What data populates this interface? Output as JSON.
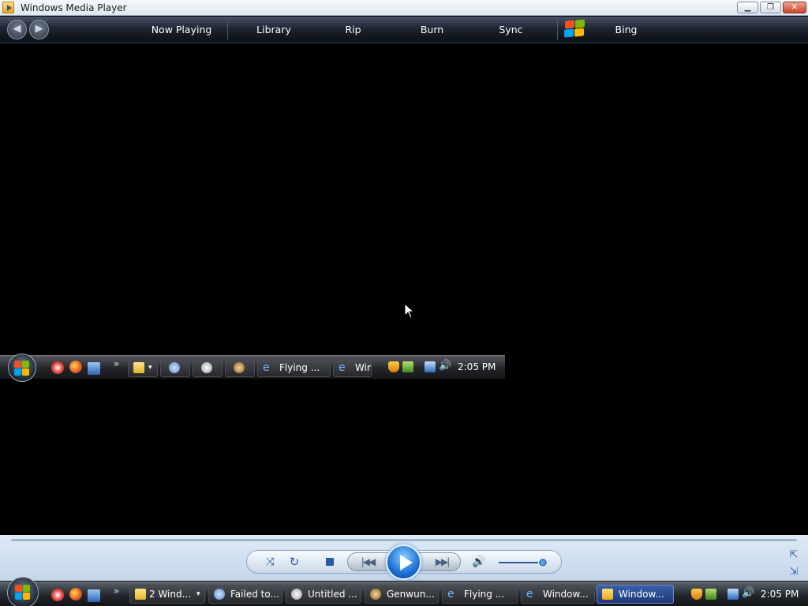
{
  "window": {
    "title": "Windows Media Player",
    "controls": {
      "minimize": "▁",
      "maximize": "❐",
      "close": "✕"
    }
  },
  "nav": {
    "back_icon": "arrow-left-icon",
    "forward_icon": "arrow-right-icon",
    "tabs": [
      {
        "label": "Now Playing"
      },
      {
        "label": "Library"
      },
      {
        "label": "Rip"
      },
      {
        "label": "Burn"
      },
      {
        "label": "Sync"
      },
      {
        "label": "Bing"
      }
    ]
  },
  "mini_taskbar": {
    "buttons": [
      {
        "label": ""
      },
      {
        "label": ""
      },
      {
        "label": ""
      },
      {
        "label": ""
      },
      {
        "label": "Flying ..."
      },
      {
        "label": "Win"
      }
    ],
    "clock": "2:05 PM"
  },
  "player": {
    "volume": 0.9
  },
  "taskbar": {
    "buttons": [
      {
        "label": "2 Wind..."
      },
      {
        "label": "Failed to..."
      },
      {
        "label": "Untitled ..."
      },
      {
        "label": "Genwun..."
      },
      {
        "label": "Flying ..."
      },
      {
        "label": "Window..."
      },
      {
        "label": "Window..."
      }
    ],
    "clock": "2:05 PM"
  },
  "colors": {
    "nav_bg": "#1d2530",
    "controls_bg": "#c3d6ea",
    "accent_blue": "#1b6fd6",
    "taskbar_active": "#1c3a7c"
  }
}
